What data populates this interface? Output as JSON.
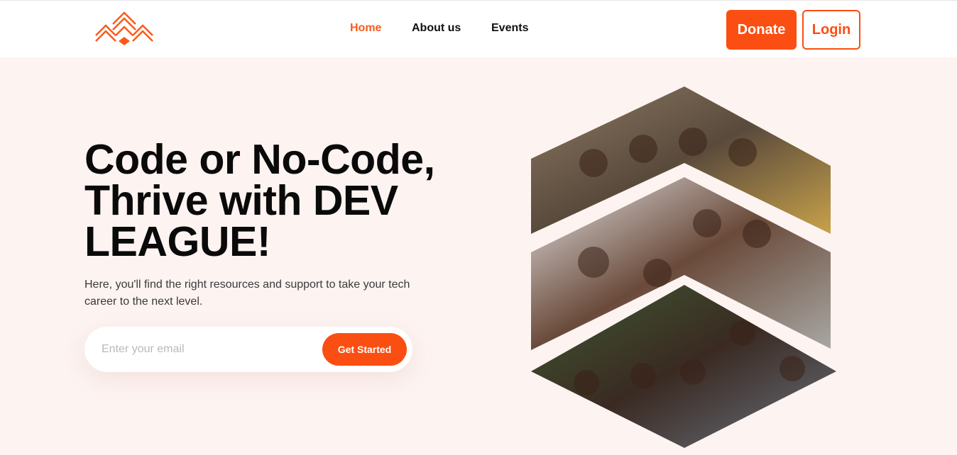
{
  "header": {
    "logo_name": "dev-league-logo",
    "nav": [
      {
        "label": "Home",
        "active": true
      },
      {
        "label": "About us",
        "active": false
      },
      {
        "label": "Events",
        "active": false
      }
    ],
    "donate_label": "Donate",
    "login_label": "Login"
  },
  "hero": {
    "title": "Code or No-Code, Thrive with DEV LEAGUE!",
    "subtitle": "Here, you'll find the right resources and support to take your tech career to the next level.",
    "email_placeholder": "Enter your email",
    "cta_label": "Get Started"
  },
  "colors": {
    "accent": "#fb4e12",
    "hero_background": "#fdf3f1",
    "header_background": "#ffffff"
  }
}
